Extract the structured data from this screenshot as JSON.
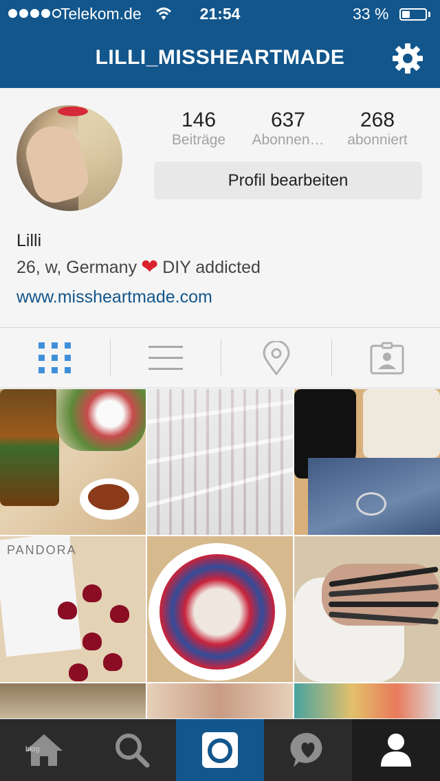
{
  "status_bar": {
    "carrier": "Telekom.de",
    "time": "21:54",
    "battery_percent_text": "33 %",
    "battery_level": 0.33
  },
  "header": {
    "title": "LILLI_MISSHEARTMADE",
    "settings_icon": "gear-icon"
  },
  "profile": {
    "stats": [
      {
        "value": "146",
        "label": "Beiträge"
      },
      {
        "value": "637",
        "label": "Abonnen…"
      },
      {
        "value": "268",
        "label": "abonniert"
      }
    ],
    "edit_button": "Profil bearbeiten",
    "name": "Lilli",
    "bio_before": "26, w, Germany",
    "bio_after": "DIY addicted",
    "website": "www.missheartmade.com"
  },
  "view_tabs": [
    {
      "icon": "grid-icon",
      "active": true
    },
    {
      "icon": "list-icon",
      "active": false
    },
    {
      "icon": "location-pin-icon",
      "active": false
    },
    {
      "icon": "tagged-photos-icon",
      "active": false
    }
  ],
  "photos": [
    {
      "name": "photo-pesto-salad"
    },
    {
      "name": "photo-shop-shelves"
    },
    {
      "name": "photo-boots-jeans"
    },
    {
      "name": "photo-pandora-gummies"
    },
    {
      "name": "photo-smoothie-bowl"
    },
    {
      "name": "photo-bracelets"
    },
    {
      "name": "photo-plants"
    },
    {
      "name": "photo-lips"
    },
    {
      "name": "photo-colorful"
    }
  ],
  "bottom_nav": [
    {
      "icon": "home-icon",
      "active": false
    },
    {
      "icon": "search-icon",
      "active": false
    },
    {
      "icon": "camera-icon",
      "active": false
    },
    {
      "icon": "activity-heart-icon",
      "active": false
    },
    {
      "icon": "profile-icon",
      "active": true
    }
  ],
  "watermark": "blog",
  "colors": {
    "brand": "#12568c",
    "nav_dark": "#2b2b2b",
    "heart": "#d9232e",
    "grid_active": "#3f8fd8"
  }
}
